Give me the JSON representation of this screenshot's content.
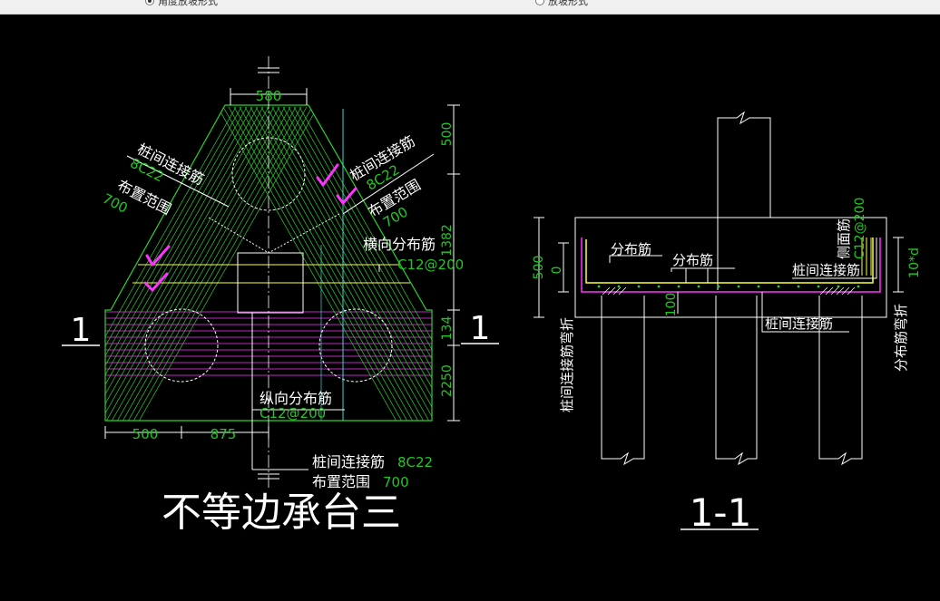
{
  "toolbar": {
    "option_left": "角度放坡形式",
    "option_right": "放坡形式",
    "selected": "left"
  },
  "plan": {
    "title": "不等边承台三",
    "section_mark": "1",
    "dim_top": "580",
    "dim_bottom_left": "500",
    "dim_bottom_mid": "875",
    "dim_right": [
      "500",
      "1382",
      "134",
      "2250"
    ],
    "left_rebar_label": "桩间连接筋",
    "left_rebar_spec": "8C22",
    "left_range_label": "布置范围",
    "left_range_value": "700",
    "right_rebar_label": "桩间连接筋",
    "right_rebar_spec": "8C22",
    "right_range_label": "布置范围",
    "right_range_value": "700",
    "transverse_label": "横向分布筋",
    "transverse_spec": "C12@200",
    "longitudinal_label": "纵向分布筋",
    "longitudinal_spec": "C12@200",
    "bottom_rebar_label": "桩间连接筋",
    "bottom_rebar_spec": "8C22",
    "bottom_range_label": "布置范围",
    "bottom_range_value": "700"
  },
  "section": {
    "title": "1-1",
    "dist_bar_1": "分布筋",
    "dist_bar_2": "分布筋",
    "pile_bar": "桩间连接筋",
    "pile_bar_bottom": "桩间连接筋",
    "side_bar": "侧面筋",
    "side_spec": "C12@200",
    "dim_500": "500",
    "dim_0": "0",
    "dim_100": "100",
    "left_bend": "桩间连接筋弯折",
    "right_bend": "分布筋弯折",
    "right_bend_value": "10*d"
  },
  "colors": {
    "background": "#000000",
    "outline": "#ffffff",
    "rebar_green": "#2bd12b",
    "dimension_text": "#22c822",
    "magenta": "#ff33ff",
    "yellow": "#ffff33",
    "cyan": "#33dddd"
  }
}
